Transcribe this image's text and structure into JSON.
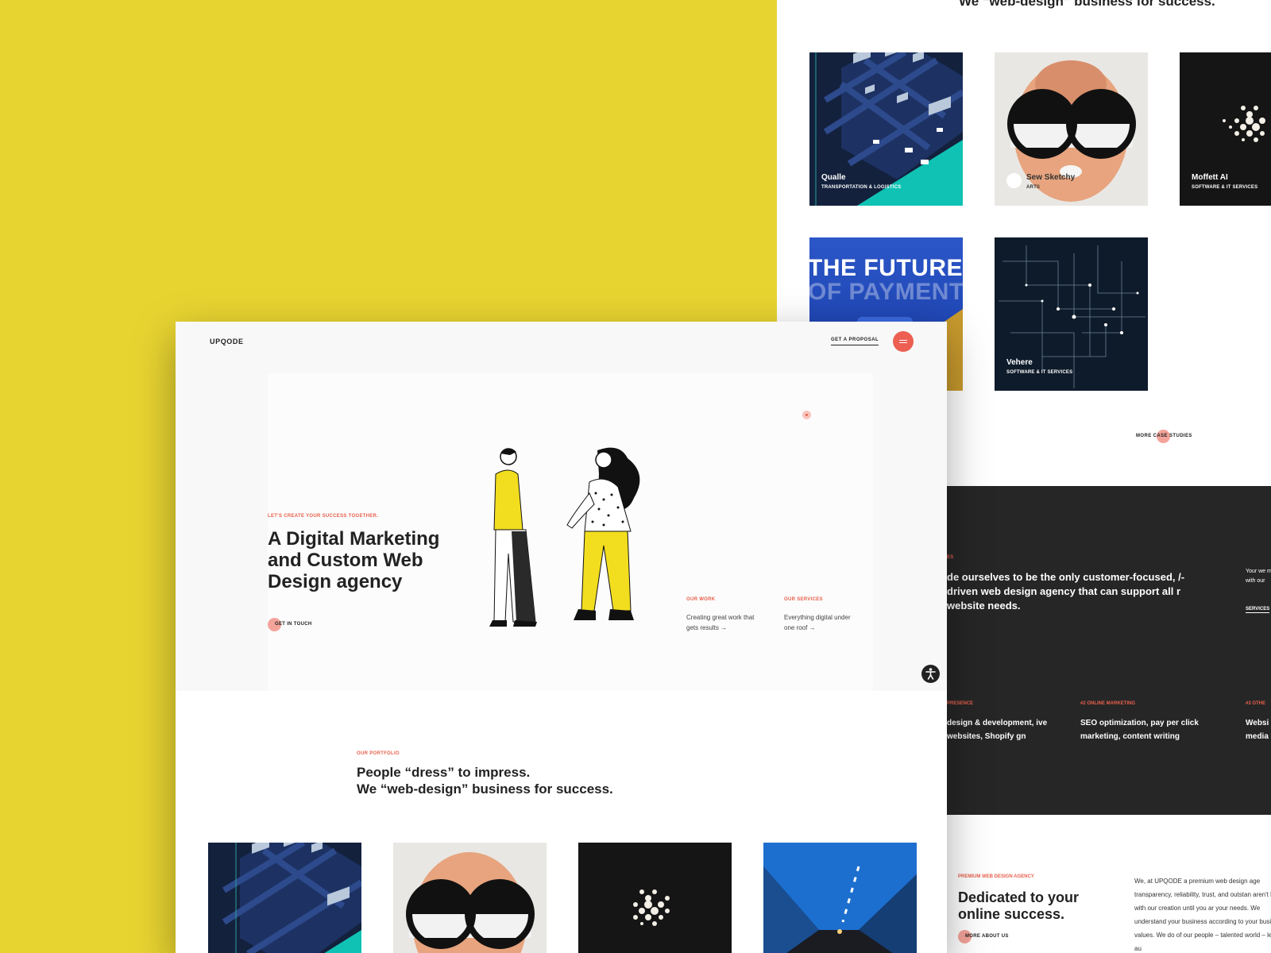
{
  "background_page": {
    "cut_headline": "We “web-design” business for success.",
    "cards": [
      {
        "name": "Qualle",
        "category": "TRANSPORTATION & LOGISTICS"
      },
      {
        "name": "Sew Sketchy",
        "category": "ARTS"
      },
      {
        "name": "Moffett AI",
        "category": "SOFTWARE & IT SERVICES"
      },
      {
        "name": "",
        "category": "",
        "image_text_line1": "THE FUTURE",
        "image_text_line2": "OF PAYMENTS"
      },
      {
        "name": "Vehere",
        "category": "SOFTWARE & IT SERVICES"
      }
    ],
    "more_case_studies": "MORE CASE STUDIES",
    "dark_section": {
      "label": "ES",
      "headline": "de ourselves to be the only customer-focused, /-driven web design agency that can support all r website needs.",
      "right_text": "Your we make it with our",
      "services_link": "SERVICES",
      "columns": [
        {
          "label": "PRESENCE",
          "text": "design & development, ive websites, Shopify gn"
        },
        {
          "label": "#2 ONLINE MARKETING",
          "text": "SEO optimization, pay per click marketing, content writing"
        },
        {
          "label": "#3 OTHE",
          "text": "Websi media analy"
        }
      ]
    },
    "agency": {
      "label": "PREMIUM WEB DESIGN AGENCY",
      "title": "Dedicated to your online success.",
      "more_about": "MORE ABOUT US",
      "text": "We, at UPQODE a premium web design age transparency, reliability, trust, and outstan aren't happy with our creation until you ar your needs. We understand your business according to your business values. We do of our people – talented world – leading au"
    }
  },
  "foreground_page": {
    "logo": "UPQODE",
    "get_proposal": "GET A PROPOSAL",
    "tagline": "LET'S CREATE YOUR SUCCESS TOGETHER.",
    "headline": "A Digital Marketing and Custom Web Design agency",
    "cta": "GET IN TOUCH",
    "our_work": {
      "label": "OUR WORK",
      "text": "Creating great work that gets results"
    },
    "our_services": {
      "label": "OUR SERVICES",
      "text": "Everything digital under one roof"
    },
    "arrow": "→",
    "portfolio": {
      "label": "OUR PORTFOLIO",
      "title_line1": "People “dress” to impress.",
      "title_line2": "We “web-design” business for success."
    }
  },
  "colors": {
    "backdrop_yellow": "#E8D431",
    "accent_red": "#EC5F52",
    "accent_pink": "#F4A39A",
    "dark_section": "#262626",
    "illustration_yellow": "#F2DE1F"
  },
  "icons": [
    "menu-icon",
    "accessibility-icon",
    "arrow-right-icon"
  ]
}
